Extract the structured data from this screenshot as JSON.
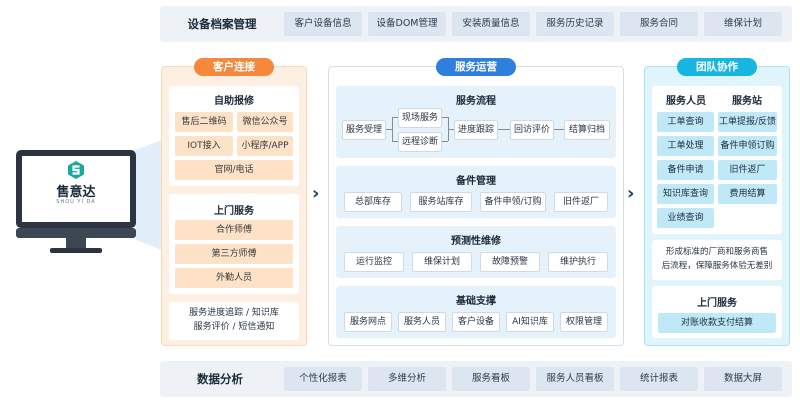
{
  "archive": {
    "title": "设备档案管理",
    "items": [
      "客户设备信息",
      "设备DOM管理",
      "安装质量信息",
      "服务历史记录",
      "服务合同",
      "维保计划"
    ]
  },
  "monitor": {
    "brand": "售意达",
    "brand_sub": "SHOU YI DA"
  },
  "customer": {
    "title": "客户连接",
    "self_service": {
      "title": "自助报修",
      "items": [
        "售后二维码",
        "微信公众号",
        "IOT接入",
        "小程序/APP",
        "官网/电话"
      ]
    },
    "onsite": {
      "title": "上门服务",
      "items": [
        "合作师傅",
        "第三方师傅",
        "外勤人员"
      ]
    },
    "footer": [
      "服务进度追踪 / 知识库",
      "服务评价 / 短信通知"
    ]
  },
  "operations": {
    "title": "服务运营",
    "process": {
      "title": "服务流程",
      "items": [
        "服务受理",
        "现场服务",
        "远程诊断",
        "进度跟踪",
        "回访评价",
        "结算归档"
      ]
    },
    "spare": {
      "title": "备件管理",
      "items": [
        "总部库存",
        "服务站库存",
        "备件申领/订购",
        "旧件返厂"
      ]
    },
    "predictive": {
      "title": "预测性维修",
      "items": [
        "运行监控",
        "维保计划",
        "故障预警",
        "维护执行"
      ]
    },
    "support": {
      "title": "基础支撑",
      "items": [
        "服务网点",
        "服务人员",
        "客户设备",
        "AI知识库",
        "权限管理"
      ]
    }
  },
  "team": {
    "title": "团队协作",
    "staff": {
      "title": "服务人员",
      "items": [
        "工单查询",
        "工单处理",
        "备件申请",
        "知识库查询",
        "业绩查询"
      ]
    },
    "station": {
      "title": "服务站",
      "items": [
        "工单提报/反馈",
        "备件申领订购",
        "旧件返厂",
        "费用结算"
      ]
    },
    "note": [
      "形成标准的厂商和服务商售",
      "后流程，保障服务体验无差别"
    ],
    "onsite": {
      "title": "上门服务",
      "items": [
        "对账收款支付结算"
      ]
    }
  },
  "analytics": {
    "title": "数据分析",
    "items": [
      "个性化报表",
      "多维分析",
      "服务看板",
      "服务人员看板",
      "统计报表",
      "数据大屏"
    ]
  },
  "colors": {
    "orange": "#f5883a",
    "blue": "#2f7fdc",
    "cyan": "#17b6e0",
    "logo_teal": "#1aa99b"
  }
}
